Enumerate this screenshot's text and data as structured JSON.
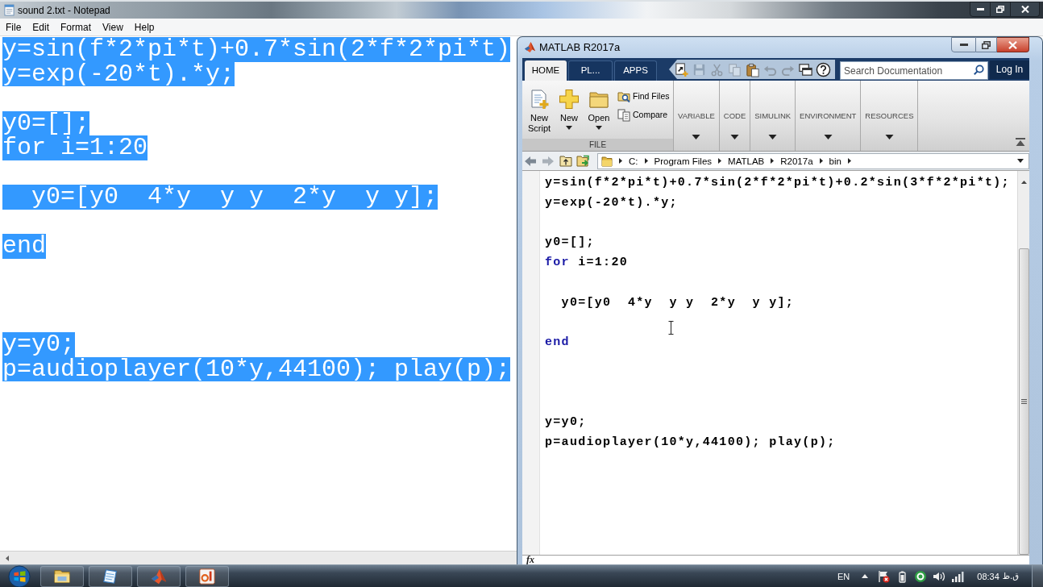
{
  "notepad": {
    "title": "sound 2.txt - Notepad",
    "menu": [
      "File",
      "Edit",
      "Format",
      "View",
      "Help"
    ],
    "lines": [
      {
        "kind": "code",
        "text": "y=sin(f*2*pi*t)+0.7*sin(2*f*2*pi*t)",
        "selected": true
      },
      {
        "kind": "code",
        "text": "y=exp(-20*t).*y;",
        "selected": true
      },
      {
        "kind": "blank"
      },
      {
        "kind": "code",
        "text": "y0=[];",
        "selected": true
      },
      {
        "kind": "code",
        "text": "for i=1:20",
        "selected": true
      },
      {
        "kind": "blank"
      },
      {
        "kind": "code",
        "text": "  y0=[y0  4*y  y y  2*y  y y];",
        "selected": true
      },
      {
        "kind": "blank"
      },
      {
        "kind": "code",
        "text": "end",
        "selected": true
      },
      {
        "kind": "blank"
      },
      {
        "kind": "blank"
      },
      {
        "kind": "blank"
      },
      {
        "kind": "code",
        "text": "y=y0;",
        "selected": true
      },
      {
        "kind": "code",
        "text": "p=audioplayer(10*y,44100); play(p);",
        "selected": true
      }
    ]
  },
  "matlab": {
    "title": "MATLAB R2017a",
    "tabs": [
      {
        "label": "HOME",
        "selected": true
      },
      {
        "label": "PL...",
        "selected": false
      },
      {
        "label": "APPS",
        "selected": false
      }
    ],
    "quick_access": [
      {
        "disabled": false
      },
      {
        "disabled": true
      },
      {
        "disabled": true
      },
      {
        "disabled": true
      },
      {
        "disabled": false
      },
      {
        "disabled": true
      },
      {
        "disabled": true
      },
      {
        "disabled": false
      },
      {
        "disabled": false
      }
    ],
    "search": {
      "placeholder": "Search Documentation"
    },
    "login_button": "Log In",
    "file_section": {
      "label": "FILE",
      "large_buttons": [
        {
          "label": "New Script",
          "dropdown": false
        },
        {
          "label": "New",
          "dropdown": true
        },
        {
          "label": "Open",
          "dropdown": true
        }
      ],
      "small_buttons": [
        "Find Files",
        "Compare"
      ]
    },
    "collapsed_sections": [
      "VARIABLE",
      "CODE",
      "SIMULINK",
      "ENVIRONMENT",
      "RESOURCES"
    ],
    "path": [
      "C:",
      "Program Files",
      "MATLAB",
      "R2017a",
      "bin"
    ],
    "editor_lines": [
      {
        "kind": "code",
        "segments": [
          {
            "text": "y=sin(f*2*pi*t)+0.7*sin(2*f*2*pi*t)+0.2*sin(3*f*2*pi*t);",
            "keyword": false
          }
        ]
      },
      {
        "kind": "code",
        "segments": [
          {
            "text": "y=exp(-20*t).*y;",
            "keyword": false
          }
        ]
      },
      {
        "kind": "blank"
      },
      {
        "kind": "code",
        "segments": [
          {
            "text": "y0=[];",
            "keyword": false
          }
        ]
      },
      {
        "kind": "code",
        "segments": [
          {
            "text": "for",
            "keyword": true
          },
          {
            "text": " i=1:20",
            "keyword": false
          }
        ]
      },
      {
        "kind": "blank"
      },
      {
        "kind": "code",
        "segments": [
          {
            "text": "  y0=[y0  4*y  y y  2*y  y y];",
            "keyword": false
          }
        ]
      },
      {
        "kind": "blank"
      },
      {
        "kind": "code",
        "segments": [
          {
            "text": "end",
            "keyword": true
          }
        ]
      },
      {
        "kind": "blank"
      },
      {
        "kind": "blank"
      },
      {
        "kind": "blank"
      },
      {
        "kind": "code",
        "segments": [
          {
            "text": "y=y0;",
            "keyword": false
          }
        ]
      },
      {
        "kind": "code",
        "segments": [
          {
            "text": "p=audioplayer(10*y,44100); play(p);",
            "keyword": false
          }
        ]
      }
    ],
    "command_prompt": "fx"
  },
  "taskbar": {
    "language": "EN",
    "clock_time": "08:34",
    "clock_period": "ق.ظ"
  }
}
